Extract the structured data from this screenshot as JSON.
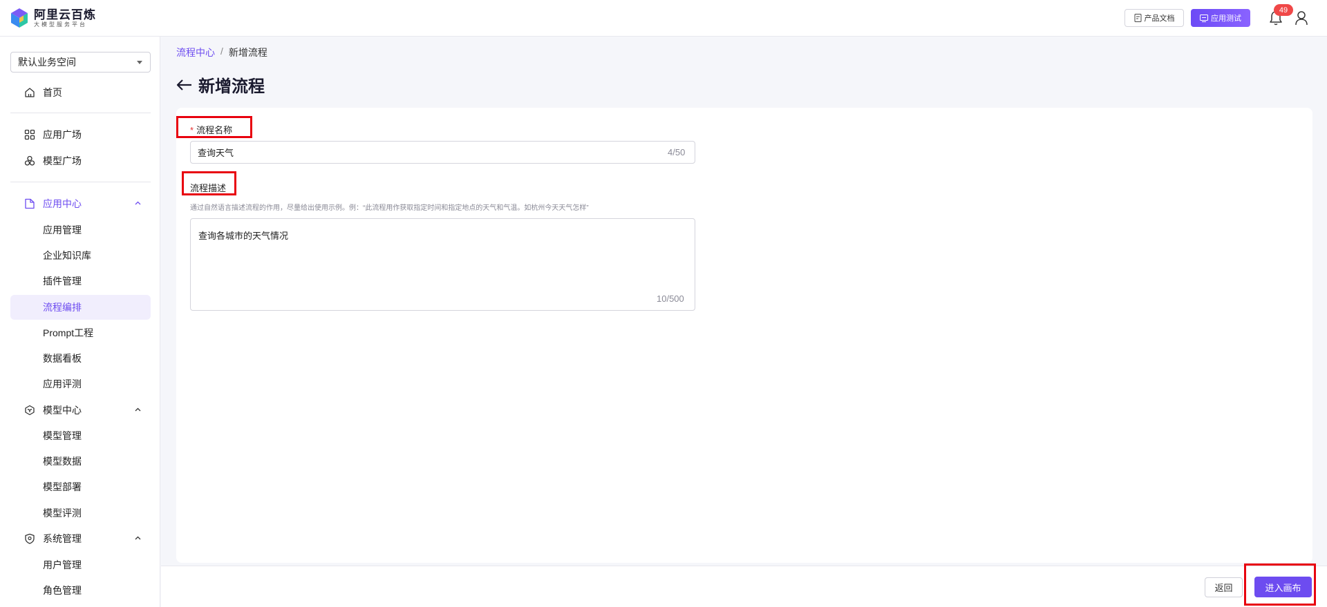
{
  "header": {
    "logo_title": "阿里云百炼",
    "logo_subtitle": "大模型服务平台",
    "docs_label": "产品文档",
    "apptest_label": "应用测试",
    "notification_count": "49",
    "accent_color": "#6d4cf0"
  },
  "sidebar": {
    "workspace": "默认业务空间",
    "home": "首页",
    "app_square": "应用广场",
    "model_square": "模型广场",
    "app_center": {
      "label": "应用中心",
      "items": [
        "应用管理",
        "企业知识库",
        "插件管理",
        "流程编排",
        "Prompt工程",
        "数据看板",
        "应用评测"
      ]
    },
    "model_center": {
      "label": "模型中心",
      "items": [
        "模型管理",
        "模型数据",
        "模型部署",
        "模型评测"
      ]
    },
    "system": {
      "label": "系统管理",
      "items": [
        "用户管理",
        "角色管理"
      ]
    },
    "active_item": "流程编排"
  },
  "breadcrumb": {
    "parent": "流程中心",
    "separator": "/",
    "current": "新增流程"
  },
  "page": {
    "title": "新增流程"
  },
  "form": {
    "name_required_mark": "*",
    "name_label": "流程名称",
    "name_value": "查询天气",
    "name_counter": "4/50",
    "desc_label": "流程描述",
    "desc_hint": "通过自然语言描述流程的作用，尽量给出使用示例。例：“此流程用作获取指定时间和指定地点的天气和气温。如杭州今天天气怎样”",
    "desc_value": "查询各城市的天气情况",
    "desc_counter": "10/500"
  },
  "footer": {
    "back_label": "返回",
    "enter_label": "进入画布"
  }
}
